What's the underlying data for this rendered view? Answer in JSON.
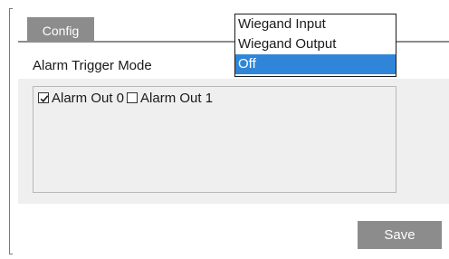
{
  "tabs": [
    {
      "label": "Config",
      "active": true
    }
  ],
  "form": {
    "alarm_trigger_mode_label": "Alarm Trigger Mode",
    "alarm_trigger_mode_options": [
      "Wiegand Input",
      "Wiegand Output",
      "Off"
    ],
    "alarm_trigger_mode_selected": "Off"
  },
  "alarm_outputs": [
    {
      "label": "Alarm Out 0",
      "checked": true
    },
    {
      "label": "Alarm Out 1",
      "checked": false
    }
  ],
  "actions": {
    "save_label": "Save"
  },
  "colors": {
    "tab_bg": "#8c8c8c",
    "panel_bg": "#efefef",
    "selected_option_bg": "#2f86d8",
    "button_bg": "#8c8c8c"
  }
}
